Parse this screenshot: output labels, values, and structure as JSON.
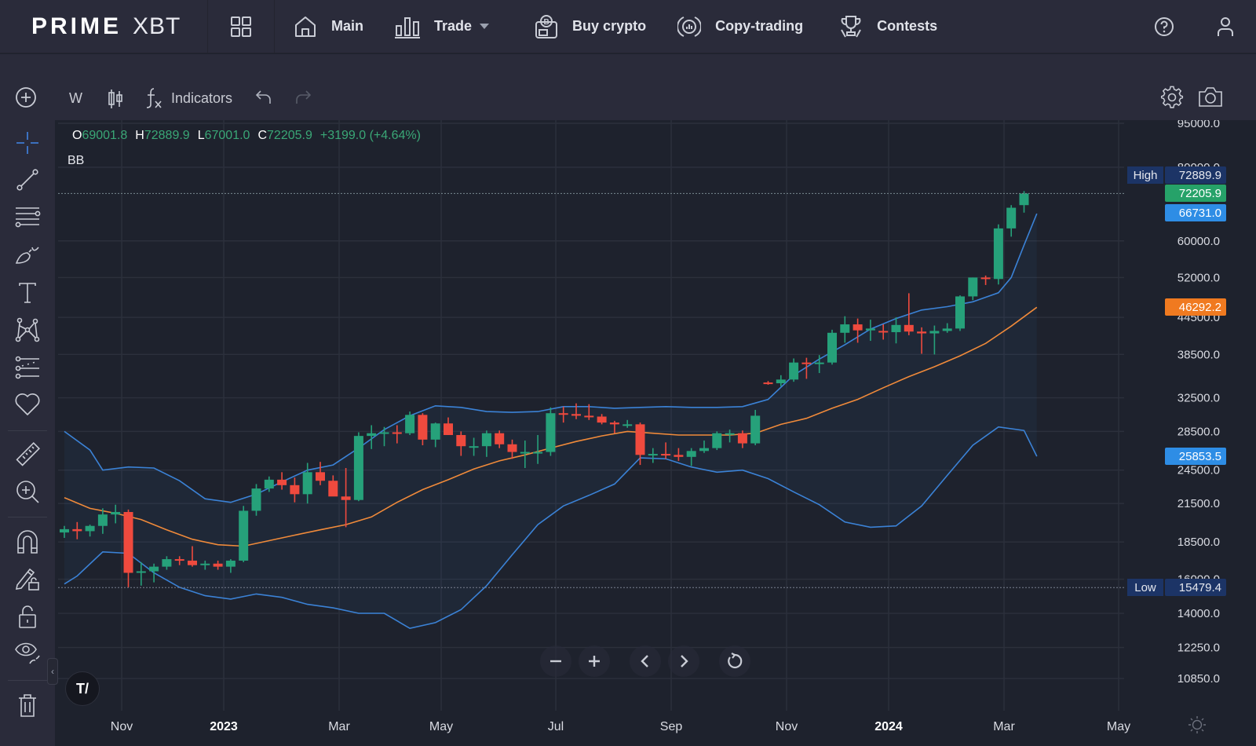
{
  "app": {
    "logo_bold": "PRIME",
    "logo_light": "XBT"
  },
  "nav": {
    "items": [
      {
        "label": "Main",
        "icon": "home-icon"
      },
      {
        "label": "Trade",
        "icon": "bar-chart-icon",
        "dropdown": true
      },
      {
        "label": "Buy crypto",
        "icon": "buy-crypto-icon"
      },
      {
        "label": "Copy-trading",
        "icon": "copy-trading-icon"
      },
      {
        "label": "Contests",
        "icon": "trophy-icon"
      }
    ],
    "right_icons": [
      "help-icon",
      "user-icon"
    ]
  },
  "toolbar": {
    "interval": "W",
    "indicators_label": "Indicators",
    "icons": [
      "add-icon",
      "candle-type-icon",
      "fx-icon",
      "undo-icon",
      "redo-icon",
      "settings-icon",
      "camera-icon"
    ]
  },
  "sidebar": {
    "tools": [
      "crosshair-icon",
      "trend-line-icon",
      "fib-retracement-icon",
      "brush-icon",
      "text-icon",
      "pattern-icon",
      "prediction-icon",
      "favorites-heart-icon",
      "ruler-icon",
      "zoom-in-icon",
      "magnet-icon",
      "lock-drawing-icon",
      "lock-icon",
      "eye-icon",
      "trash-icon"
    ]
  },
  "legend": {
    "open_label": "O",
    "open": "69001.8",
    "high_label": "H",
    "high": "72889.9",
    "low_label": "L",
    "low": "67001.0",
    "close_label": "C",
    "close": "72205.9",
    "change": "+3199.0 (+4.64%)",
    "indicator": "BB"
  },
  "price_tags": {
    "high_label": "High",
    "high": "72889.9",
    "last": "72205.9",
    "bb_upper": "66731.0",
    "bb_basis": "46292.2",
    "bb_lower": "25853.5",
    "low_label": "Low",
    "low": "15479.4"
  },
  "colors": {
    "up": "#26a17a",
    "down": "#ef4a3e",
    "bb_band": "#3b82d6",
    "bb_basis": "#f08a3a",
    "last_tag": "#26a269",
    "upper_tag": "#2e8de5",
    "basis_tag": "#f07a20",
    "hilo_tag": "#1c3466"
  },
  "chart_data": {
    "type": "candlestick",
    "title": "",
    "interval": "W",
    "scale": "log",
    "xlabel": "",
    "ylabel": "",
    "y_ticks": [
      "95000.0",
      "80000.0",
      "60000.0",
      "52000.0",
      "44500.0",
      "38500.0",
      "32500.0",
      "28500.0",
      "24500.0",
      "21500.0",
      "18500.0",
      "16000.0",
      "14000.0",
      "12250.0",
      "10850.0"
    ],
    "ylim": [
      9800,
      101000
    ],
    "x_ticks": [
      {
        "label": "Nov",
        "year": false
      },
      {
        "label": "2023",
        "year": true
      },
      {
        "label": "Mar",
        "year": false
      },
      {
        "label": "May",
        "year": false
      },
      {
        "label": "Jul",
        "year": false
      },
      {
        "label": "Sep",
        "year": false
      },
      {
        "label": "Nov",
        "year": false
      },
      {
        "label": "2024",
        "year": true
      },
      {
        "label": "Mar",
        "year": false
      },
      {
        "label": "May",
        "year": false
      }
    ],
    "candles": [
      [
        19200,
        19700,
        18800,
        19450
      ],
      [
        19450,
        20000,
        18700,
        19300
      ],
      [
        19300,
        19800,
        18900,
        19700
      ],
      [
        19700,
        21100,
        19100,
        20600
      ],
      [
        20600,
        21400,
        19900,
        20800
      ],
      [
        20800,
        21000,
        15500,
        16400
      ],
      [
        16400,
        17100,
        15600,
        16500
      ],
      [
        16500,
        17000,
        15800,
        16800
      ],
      [
        16800,
        17500,
        16600,
        17300
      ],
      [
        17300,
        17500,
        16900,
        17200
      ],
      [
        17200,
        18200,
        16800,
        16900
      ],
      [
        16900,
        17200,
        16600,
        17000
      ],
      [
        17000,
        17200,
        16600,
        16800
      ],
      [
        16800,
        17300,
        16400,
        17200
      ],
      [
        17200,
        21300,
        17100,
        20900
      ],
      [
        20900,
        23200,
        20500,
        22800
      ],
      [
        22800,
        23900,
        22500,
        23600
      ],
      [
        23600,
        24300,
        22700,
        23100
      ],
      [
        23100,
        23800,
        21600,
        22300
      ],
      [
        22300,
        25200,
        21500,
        24300
      ],
      [
        24300,
        25300,
        23100,
        23500
      ],
      [
        23500,
        24000,
        22400,
        22100
      ],
      [
        22100,
        24700,
        19600,
        21800
      ],
      [
        21800,
        28400,
        21700,
        28000
      ],
      [
        28000,
        29200,
        26600,
        28300
      ],
      [
        28300,
        29000,
        26900,
        28400
      ],
      [
        28400,
        29200,
        27200,
        28300
      ],
      [
        28300,
        30800,
        28100,
        30400
      ],
      [
        30400,
        30600,
        27000,
        27600
      ],
      [
        27600,
        29500,
        26800,
        29400
      ],
      [
        29400,
        30100,
        28100,
        28100
      ],
      [
        28100,
        28500,
        25900,
        26900
      ],
      [
        26900,
        27800,
        25900,
        26900
      ],
      [
        26900,
        28600,
        25800,
        28300
      ],
      [
        28300,
        28600,
        26700,
        27100
      ],
      [
        27100,
        27600,
        25600,
        26300
      ],
      [
        26300,
        27500,
        24700,
        26300
      ],
      [
        26300,
        28100,
        25100,
        26300
      ],
      [
        26300,
        31300,
        25900,
        30600
      ],
      [
        30600,
        31400,
        29500,
        30500
      ],
      [
        30500,
        31800,
        29900,
        30300
      ],
      [
        30300,
        31700,
        29800,
        30200
      ],
      [
        30200,
        30500,
        29300,
        29500
      ],
      [
        29500,
        29700,
        28300,
        29300
      ],
      [
        29300,
        29800,
        28900,
        29300
      ],
      [
        29300,
        29500,
        25000,
        26000
      ],
      [
        26000,
        26700,
        25200,
        26100
      ],
      [
        26100,
        27300,
        25600,
        26000
      ],
      [
        26000,
        26700,
        25400,
        25800
      ],
      [
        25800,
        26700,
        24900,
        26400
      ],
      [
        26400,
        27500,
        26200,
        26700
      ],
      [
        26700,
        28500,
        26500,
        28300
      ],
      [
        28300,
        28700,
        27300,
        28300
      ],
      [
        28300,
        28600,
        26700,
        27200
      ],
      [
        27200,
        31000,
        27000,
        30300
      ],
      [
        34500,
        34700,
        34200,
        34400
      ],
      [
        34400,
        35500,
        34000,
        34900
      ],
      [
        34900,
        37900,
        34600,
        37300
      ],
      [
        37300,
        38000,
        35000,
        37200
      ],
      [
        37300,
        38400,
        35800,
        37300
      ],
      [
        37300,
        42400,
        37000,
        41900
      ],
      [
        41900,
        44700,
        40300,
        43300
      ],
      [
        43300,
        44300,
        40300,
        42300
      ],
      [
        42300,
        44100,
        40600,
        42600
      ],
      [
        42200,
        43300,
        40800,
        42000
      ],
      [
        42000,
        44500,
        40200,
        43200
      ],
      [
        43200,
        48900,
        41500,
        42100
      ],
      [
        42100,
        42800,
        38600,
        41800
      ],
      [
        41800,
        43100,
        38500,
        42200
      ],
      [
        42200,
        43500,
        41900,
        42600
      ],
      [
        42600,
        48500,
        42200,
        48300
      ],
      [
        48300,
        52000,
        47600,
        52000
      ],
      [
        52000,
        52400,
        50500,
        51700
      ],
      [
        51700,
        64000,
        50600,
        63000
      ],
      [
        63000,
        69000,
        61000,
        68300
      ],
      [
        69000,
        72890,
        67001,
        72206
      ]
    ],
    "bb_upper": [
      [
        0,
        28500
      ],
      [
        2,
        26500
      ],
      [
        3,
        24500
      ],
      [
        5,
        24800
      ],
      [
        7,
        24700
      ],
      [
        9,
        23500
      ],
      [
        11,
        21900
      ],
      [
        13,
        21600
      ],
      [
        15,
        22300
      ],
      [
        17,
        23400
      ],
      [
        19,
        24500
      ],
      [
        21,
        25000
      ],
      [
        23,
        26700
      ],
      [
        25,
        28700
      ],
      [
        27,
        30300
      ],
      [
        29,
        31500
      ],
      [
        31,
        31300
      ],
      [
        33,
        30800
      ],
      [
        35,
        30700
      ],
      [
        37,
        30800
      ],
      [
        39,
        31400
      ],
      [
        41,
        31400
      ],
      [
        43,
        31200
      ],
      [
        45,
        31300
      ],
      [
        47,
        31400
      ],
      [
        49,
        31300
      ],
      [
        51,
        31300
      ],
      [
        53,
        31400
      ],
      [
        55,
        32300
      ],
      [
        57,
        35500
      ],
      [
        59,
        37800
      ],
      [
        61,
        40000
      ],
      [
        63,
        42500
      ],
      [
        65,
        44300
      ],
      [
        67,
        45800
      ],
      [
        69,
        46400
      ],
      [
        71,
        47300
      ],
      [
        73,
        49000
      ],
      [
        74,
        52000
      ],
      [
        75,
        59000
      ],
      [
        76,
        66731
      ]
    ],
    "bb_basis": [
      [
        0,
        22000
      ],
      [
        2,
        21100
      ],
      [
        4,
        20700
      ],
      [
        6,
        20200
      ],
      [
        8,
        19400
      ],
      [
        10,
        18700
      ],
      [
        12,
        18300
      ],
      [
        14,
        18200
      ],
      [
        16,
        18600
      ],
      [
        18,
        19000
      ],
      [
        20,
        19400
      ],
      [
        22,
        19800
      ],
      [
        24,
        20400
      ],
      [
        26,
        21600
      ],
      [
        28,
        22700
      ],
      [
        30,
        23600
      ],
      [
        32,
        24600
      ],
      [
        34,
        25400
      ],
      [
        36,
        26000
      ],
      [
        38,
        26700
      ],
      [
        40,
        27400
      ],
      [
        42,
        28000
      ],
      [
        44,
        28500
      ],
      [
        46,
        28300
      ],
      [
        48,
        28100
      ],
      [
        50,
        28100
      ],
      [
        52,
        28100
      ],
      [
        54,
        28300
      ],
      [
        56,
        29300
      ],
      [
        58,
        30000
      ],
      [
        60,
        31200
      ],
      [
        62,
        32300
      ],
      [
        64,
        33800
      ],
      [
        66,
        35300
      ],
      [
        68,
        36700
      ],
      [
        70,
        38300
      ],
      [
        72,
        40200
      ],
      [
        74,
        43000
      ],
      [
        76,
        46292
      ]
    ],
    "bb_lower": [
      [
        0,
        15700
      ],
      [
        1,
        16200
      ],
      [
        3,
        17800
      ],
      [
        5,
        17700
      ],
      [
        7,
        16400
      ],
      [
        9,
        15500
      ],
      [
        11,
        15000
      ],
      [
        13,
        14800
      ],
      [
        15,
        15100
      ],
      [
        17,
        14900
      ],
      [
        19,
        14500
      ],
      [
        21,
        14300
      ],
      [
        23,
        14000
      ],
      [
        25,
        14000
      ],
      [
        27,
        13200
      ],
      [
        29,
        13500
      ],
      [
        31,
        14200
      ],
      [
        33,
        15600
      ],
      [
        35,
        17600
      ],
      [
        37,
        19800
      ],
      [
        39,
        21300
      ],
      [
        41,
        22200
      ],
      [
        43,
        23200
      ],
      [
        45,
        25700
      ],
      [
        47,
        25600
      ],
      [
        49,
        24800
      ],
      [
        51,
        24300
      ],
      [
        53,
        24500
      ],
      [
        55,
        23700
      ],
      [
        57,
        22500
      ],
      [
        59,
        21400
      ],
      [
        61,
        20000
      ],
      [
        63,
        19600
      ],
      [
        65,
        19700
      ],
      [
        67,
        21300
      ],
      [
        69,
        24000
      ],
      [
        71,
        27000
      ],
      [
        73,
        29000
      ],
      [
        75,
        28600
      ],
      [
        76,
        25853.5
      ]
    ]
  },
  "chart_controls": {
    "buttons": [
      "zoom-out-icon",
      "zoom-in-icon",
      "scroll-left-icon",
      "scroll-right-icon",
      "reset-icon"
    ]
  }
}
